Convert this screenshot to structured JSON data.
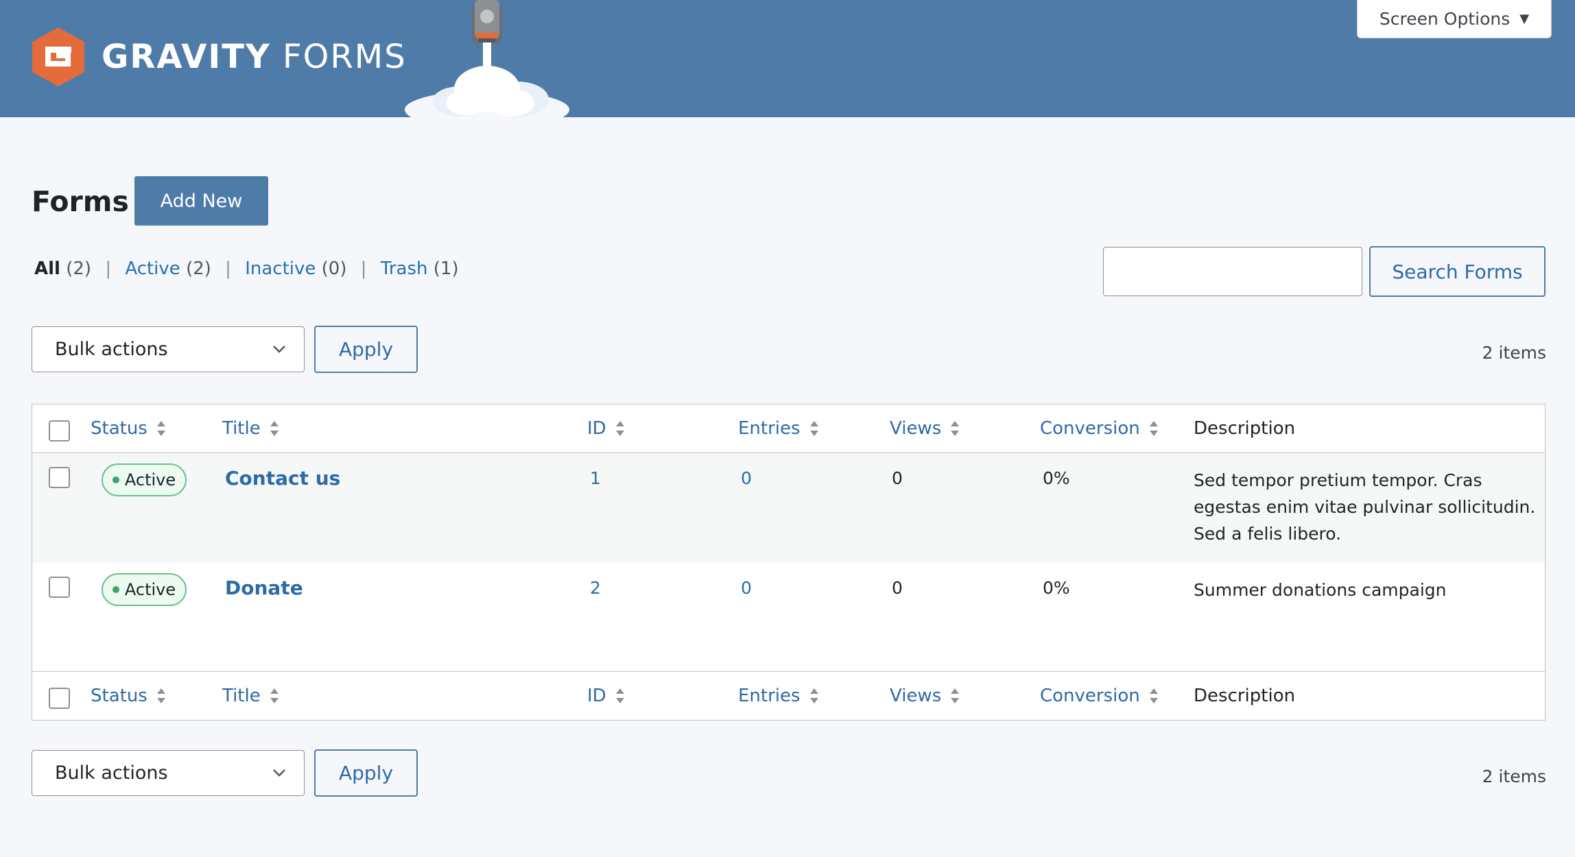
{
  "header": {
    "brand_bold": "GRAVITY",
    "brand_light": "FORMS",
    "bg_color": "#4f7ba8",
    "logo_color": "#e56b3a",
    "screen_options_label": "Screen Options"
  },
  "page": {
    "title": "Forms",
    "add_new_label": "Add New"
  },
  "filters": [
    {
      "label": "All",
      "count": "(2)",
      "current": true
    },
    {
      "label": "Active",
      "count": "(2)",
      "current": false
    },
    {
      "label": "Inactive",
      "count": "(0)",
      "current": false
    },
    {
      "label": "Trash",
      "count": "(1)",
      "current": false
    }
  ],
  "search": {
    "value": "",
    "button_label": "Search Forms"
  },
  "toolbar": {
    "bulk_actions_label": "Bulk actions",
    "apply_label": "Apply",
    "items_count": "2 items"
  },
  "table": {
    "columns": {
      "status": "Status",
      "title": "Title",
      "id": "ID",
      "entries": "Entries",
      "views": "Views",
      "conversion": "Conversion",
      "description": "Description"
    },
    "rows": [
      {
        "status": "Active",
        "title": "Contact us",
        "id": "1",
        "entries": "0",
        "views": "0",
        "conversion": "0%",
        "description": "Sed tempor pretium tempor. Cras egestas enim vitae pulvinar sollicitudin. Sed a felis libero."
      },
      {
        "status": "Active",
        "title": "Donate",
        "id": "2",
        "entries": "0",
        "views": "0",
        "conversion": "0%",
        "description": "Summer donations campaign"
      }
    ]
  }
}
